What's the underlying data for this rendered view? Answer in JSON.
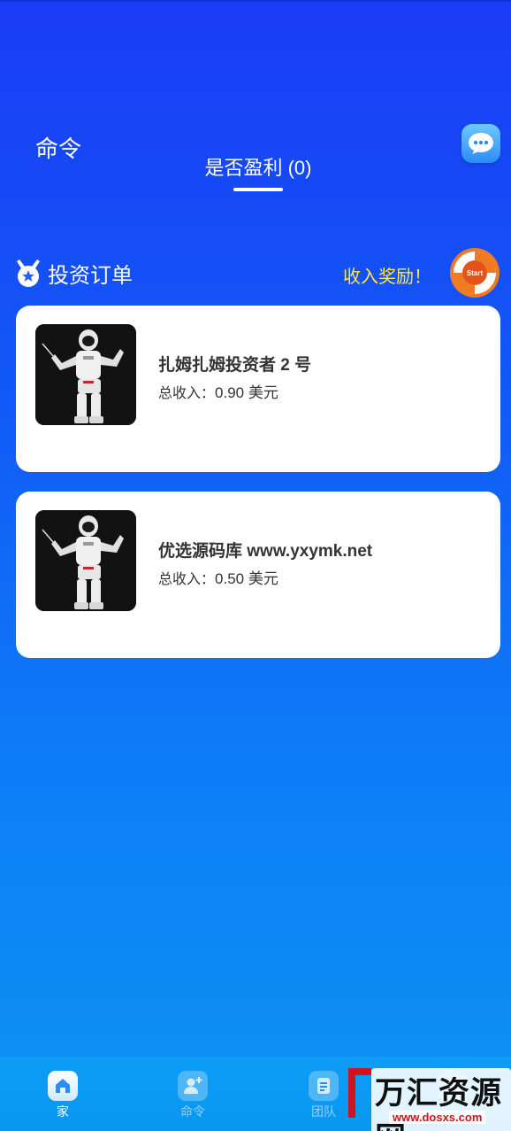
{
  "header": {
    "title": "命令",
    "tab_label": "是否盈利 (0)"
  },
  "section": {
    "title": "投资订单",
    "reward_label": "收入奖励！",
    "start_label": "Start"
  },
  "orders": [
    {
      "title": "扎姆扎姆投资者 2 号",
      "income_label": "总收入：",
      "income_value": "0.90 美元"
    },
    {
      "title": "优选源码库 www.yxymk.net",
      "income_label": "总收入：",
      "income_value": "0.50 美元"
    }
  ],
  "nav": {
    "items": [
      {
        "label": "家",
        "icon": "home-icon",
        "active": true
      },
      {
        "label": "命令",
        "icon": "add-user-icon",
        "active": false
      },
      {
        "label": "团队",
        "icon": "document-icon",
        "active": false
      },
      {
        "label": "",
        "icon": "user-icon",
        "active": false
      }
    ]
  },
  "watermark": {
    "text": "万汇资源网",
    "url": "www.dosxs.com"
  },
  "colors": {
    "accent": "#1a3cf5",
    "reward": "#ffe94a",
    "start_orange": "#f07a22"
  }
}
